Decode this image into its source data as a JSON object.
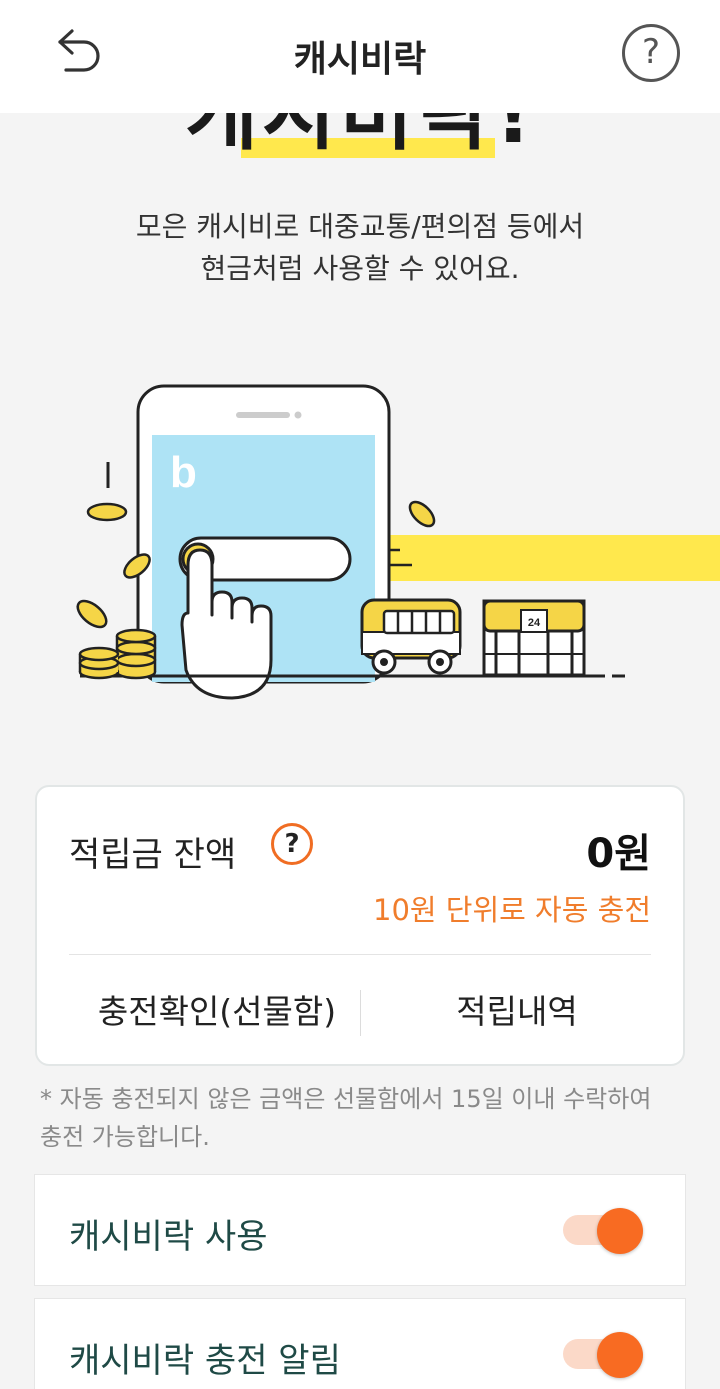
{
  "header": {
    "title": "캐시비락",
    "help_label": "?"
  },
  "hero": {
    "title": "캐시비락!",
    "description_line1": "모은 캐시비로 대중교통/편의점 등에서",
    "description_line2": "현금처럼 사용할 수 있어요.",
    "store_sign": "24",
    "app_letter": "b"
  },
  "balance_card": {
    "label": "적립금 잔액",
    "help_label": "?",
    "value": "0원",
    "auto_charge_note": "10원 단위로 자동 충전",
    "confirm_button": "충전확인(선물함)",
    "history_button": "적립내역"
  },
  "note": "* 자동 충전되지 않은 금액은 선물함에서 15일 이내 수락하여 충전 가능합니다.",
  "settings": [
    {
      "label": "캐시비락 사용",
      "enabled": true
    },
    {
      "label": "캐시비락 충전 알림",
      "enabled": true
    }
  ],
  "colors": {
    "accent": "#f86b22",
    "highlight": "#ffe84d",
    "screen_blue": "#aee3f5",
    "coin": "#f5d547"
  }
}
